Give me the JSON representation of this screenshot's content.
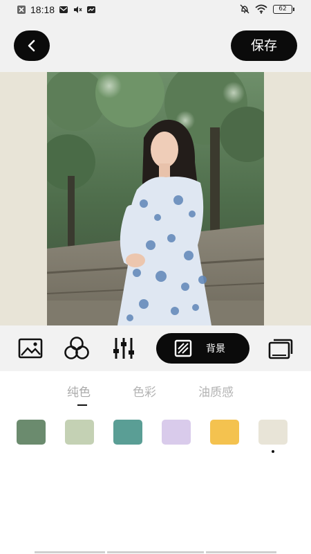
{
  "status_bar": {
    "time": "18:18",
    "battery": "62",
    "left_icons": [
      "close-box-icon",
      "mail-icon",
      "mute-icon",
      "message-icon"
    ],
    "right_icons": [
      "alarm-off-icon",
      "wifi-icon",
      "battery-icon"
    ]
  },
  "header": {
    "back_icon": "chevron-left-icon",
    "save_label": "保存"
  },
  "canvas": {
    "background_color": "#e8e4d7",
    "photo_description_icon": "photo-portrait"
  },
  "toolbar": {
    "tools": [
      "image-icon",
      "filter-circles-icon",
      "sliders-icon"
    ],
    "background_button": {
      "icon": "background-stripes-icon",
      "label": "背景"
    },
    "layers_icon": "layers-icon"
  },
  "tabs": [
    {
      "label": "纯色",
      "active": true
    },
    {
      "label": "色彩",
      "active": false
    },
    {
      "label": "油质感",
      "active": false
    }
  ],
  "swatches": [
    {
      "color": "#6b8b6e"
    },
    {
      "color": "#c4d1b4"
    },
    {
      "color": "#5a9e95"
    },
    {
      "color": "#d9cbeb"
    },
    {
      "color": "#f4c24f"
    },
    {
      "color": "#e8e4d7",
      "selected": true
    }
  ]
}
